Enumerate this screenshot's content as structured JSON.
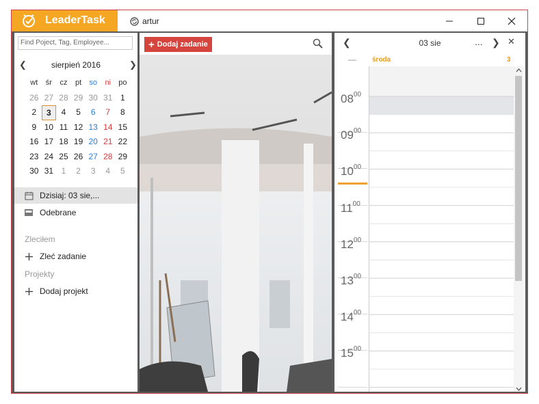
{
  "app": {
    "brand": "LeaderTask",
    "user": "artur"
  },
  "colors": {
    "brand": "#f5a623",
    "accent_red": "#d6453d",
    "today": "#f0a030"
  },
  "sidebar": {
    "search_placeholder": "Find Poject, Tag, Employee...",
    "calendar": {
      "month_title": "sierpień 2016",
      "weekdays": [
        "wt",
        "śr",
        "cz",
        "pt",
        "so",
        "ni",
        "po"
      ],
      "weeks": [
        [
          "26",
          "27",
          "28",
          "29",
          "30",
          "31",
          "1"
        ],
        [
          "2",
          "3",
          "4",
          "5",
          "6",
          "7",
          "8"
        ],
        [
          "9",
          "10",
          "11",
          "12",
          "13",
          "14",
          "15"
        ],
        [
          "16",
          "17",
          "18",
          "19",
          "20",
          "21",
          "22"
        ],
        [
          "23",
          "24",
          "25",
          "26",
          "27",
          "28",
          "29"
        ],
        [
          "30",
          "31",
          "1",
          "2",
          "3",
          "4",
          "5"
        ]
      ],
      "selected_day": "3"
    },
    "today_label": "Dzisiaj: 03 sie,...",
    "received_label": "Odebrane",
    "delegated_section": "Zleciłem",
    "delegate_task_label": "Zleć zadanie",
    "projects_section": "Projekty",
    "add_project_label": "Dodaj projekt"
  },
  "middle": {
    "add_task_label": "Dodaj zadanie"
  },
  "day_view": {
    "date_label": "03 sie",
    "more_label": "...",
    "day_name": "środa",
    "day_number": "3",
    "hours": [
      {
        "h": "08",
        "m": "00"
      },
      {
        "h": "09",
        "m": "00"
      },
      {
        "h": "10",
        "m": "00"
      },
      {
        "h": "11",
        "m": "00"
      },
      {
        "h": "12",
        "m": "00"
      },
      {
        "h": "13",
        "m": "00"
      },
      {
        "h": "14",
        "m": "00"
      },
      {
        "h": "15",
        "m": "00"
      }
    ]
  }
}
